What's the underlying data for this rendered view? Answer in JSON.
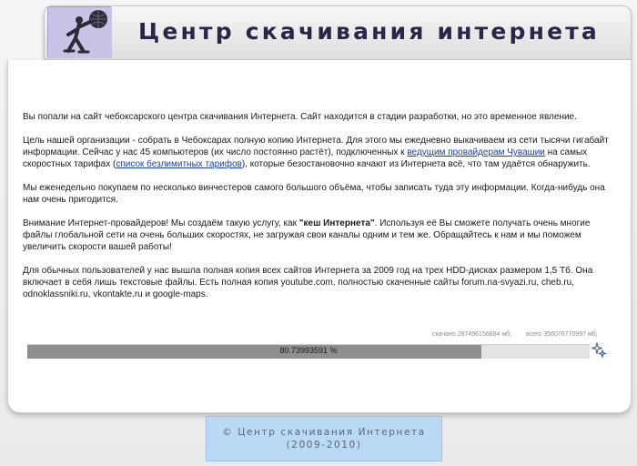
{
  "header": {
    "title": "Центр скачивания интернета",
    "logo_icon": "figure-with-globe-icon"
  },
  "main": {
    "p1": "Вы попали на сайт чебоксарского центра скачивания Интернета. Сайт находится в стадии разработки, но это временное явление.",
    "p2_a": "Цель нашей организации - собрать в Чебоксарах полную копию Интернета. Для этого мы ежедневно выкачиваем из сети тысячи гигабайт информации. Сейчас у нас 45 компьютеров (их число постоянно растёт), подключенных к ",
    "p2_link1": "ведущим провайдерам Чувашии",
    "p2_b": " на самых скоростных тарифах (",
    "p2_link2": "список безлимитных тарифов",
    "p2_c": "), которые безостановочно качают из Интернета всё, что там удаётся обнаружить.",
    "p3": "Мы еженедельно покупаем по несколько винчестеров самого большого объёма, чтобы записать туда эту информации. Когда-нибудь она нам очень пригодится.",
    "p4_a": "Внимание Интернет-провайдеров! Мы создаём такую услугу, как ",
    "p4_bold": "\"кеш Интернета\"",
    "p4_b": ". Используя её Вы сможете получать очень многие файлы глобальной сети на очень больших скоростях, не загружая свои каналы одним и тем же. Обращайтесь к нам и мы поможем увеличить скорости вашей работы!",
    "p5": "Для обычных пользователей у нас вышла полная копия всех сайтов Интернета за 2009 год на трех HDD-дисках размером 1,5 Тб. Она включает в себя лишь текстовые файлы. Есть полная копия youtube.com, полностью скаченные сайты forum.na-svyazi.ru, cheb.ru, odnoklassniki.ru, vkontakte.ru и google-maps."
  },
  "stats": {
    "downloaded": "скачано  287496156684 мб;",
    "total": "всего 356076770997 мб;"
  },
  "progress": {
    "label": "80.73993591 %",
    "fraction": 0.8074,
    "icon": "sparkle-icon"
  },
  "footer": {
    "line1": "© Центр скачивания Интернета",
    "line2": "(2009-2010)"
  },
  "colors": {
    "title": "#2e2546",
    "link": "#1a3fb0",
    "footer_bg": "#b9d9f5",
    "progress_fill": "#8f8f8f"
  }
}
